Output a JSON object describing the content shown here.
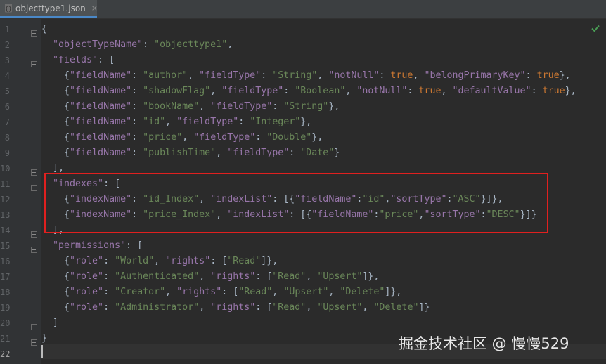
{
  "tab": {
    "title": "objecttype1.json",
    "close_glyph": "×",
    "icon": "json-file-icon"
  },
  "status": {
    "icon": "check-icon",
    "color": "#499c54"
  },
  "colors": {
    "key": "#9876aa",
    "string": "#6a8759",
    "keyword": "#cc7832",
    "punctuation": "#a9b7c6",
    "highlight_border": "#e0201f"
  },
  "editor": {
    "current_line": 22,
    "line_numbers": [
      "1",
      "2",
      "3",
      "4",
      "5",
      "6",
      "7",
      "8",
      "9",
      "10",
      "11",
      "12",
      "13",
      "14",
      "15",
      "16",
      "17",
      "18",
      "19",
      "20",
      "21",
      "22"
    ],
    "lines": [
      [
        [
          "p",
          "{"
        ]
      ],
      [
        [
          "p",
          "  "
        ],
        [
          "k",
          "\"objectTypeName\""
        ],
        [
          "p",
          ": "
        ],
        [
          "s",
          "\"objecttype1\""
        ],
        [
          "p",
          ","
        ]
      ],
      [
        [
          "p",
          "  "
        ],
        [
          "k",
          "\"fields\""
        ],
        [
          "p",
          ": ["
        ]
      ],
      [
        [
          "p",
          "    {"
        ],
        [
          "k",
          "\"fieldName\""
        ],
        [
          "p",
          ": "
        ],
        [
          "s",
          "\"author\""
        ],
        [
          "p",
          ", "
        ],
        [
          "k",
          "\"fieldType\""
        ],
        [
          "p",
          ": "
        ],
        [
          "s",
          "\"String\""
        ],
        [
          "p",
          ", "
        ],
        [
          "k",
          "\"notNull\""
        ],
        [
          "p",
          ": "
        ],
        [
          "kw",
          "true"
        ],
        [
          "p",
          ", "
        ],
        [
          "k",
          "\"belongPrimaryKey\""
        ],
        [
          "p",
          ": "
        ],
        [
          "kw",
          "true"
        ],
        [
          "p",
          "},"
        ]
      ],
      [
        [
          "p",
          "    {"
        ],
        [
          "k",
          "\"fieldName\""
        ],
        [
          "p",
          ": "
        ],
        [
          "s",
          "\"shadowFlag\""
        ],
        [
          "p",
          ", "
        ],
        [
          "k",
          "\"fieldType\""
        ],
        [
          "p",
          ": "
        ],
        [
          "s",
          "\"Boolean\""
        ],
        [
          "p",
          ", "
        ],
        [
          "k",
          "\"notNull\""
        ],
        [
          "p",
          ": "
        ],
        [
          "kw",
          "true"
        ],
        [
          "p",
          ", "
        ],
        [
          "k",
          "\"defaultValue\""
        ],
        [
          "p",
          ": "
        ],
        [
          "kw",
          "true"
        ],
        [
          "p",
          "},"
        ]
      ],
      [
        [
          "p",
          "    {"
        ],
        [
          "k",
          "\"fieldName\""
        ],
        [
          "p",
          ": "
        ],
        [
          "s",
          "\"bookName\""
        ],
        [
          "p",
          ", "
        ],
        [
          "k",
          "\"fieldType\""
        ],
        [
          "p",
          ": "
        ],
        [
          "s",
          "\"String\""
        ],
        [
          "p",
          "},"
        ]
      ],
      [
        [
          "p",
          "    {"
        ],
        [
          "k",
          "\"fieldName\""
        ],
        [
          "p",
          ": "
        ],
        [
          "s",
          "\"id\""
        ],
        [
          "p",
          ", "
        ],
        [
          "k",
          "\"fieldType\""
        ],
        [
          "p",
          ": "
        ],
        [
          "s",
          "\"Integer\""
        ],
        [
          "p",
          "},"
        ]
      ],
      [
        [
          "p",
          "    {"
        ],
        [
          "k",
          "\"fieldName\""
        ],
        [
          "p",
          ": "
        ],
        [
          "s",
          "\"price\""
        ],
        [
          "p",
          ", "
        ],
        [
          "k",
          "\"fieldType\""
        ],
        [
          "p",
          ": "
        ],
        [
          "s",
          "\"Double\""
        ],
        [
          "p",
          "},"
        ]
      ],
      [
        [
          "p",
          "    {"
        ],
        [
          "k",
          "\"fieldName\""
        ],
        [
          "p",
          ": "
        ],
        [
          "s",
          "\"publishTime\""
        ],
        [
          "p",
          ", "
        ],
        [
          "k",
          "\"fieldType\""
        ],
        [
          "p",
          ": "
        ],
        [
          "s",
          "\"Date\""
        ],
        [
          "p",
          "}"
        ]
      ],
      [
        [
          "p",
          "  ],"
        ]
      ],
      [
        [
          "p",
          "  "
        ],
        [
          "k",
          "\"indexes\""
        ],
        [
          "p",
          ": ["
        ]
      ],
      [
        [
          "p",
          "    {"
        ],
        [
          "k",
          "\"indexName\""
        ],
        [
          "p",
          ": "
        ],
        [
          "s",
          "\"id_Index\""
        ],
        [
          "p",
          ", "
        ],
        [
          "k",
          "\"indexList\""
        ],
        [
          "p",
          ": [{"
        ],
        [
          "k",
          "\"fieldName\""
        ],
        [
          "p",
          ":"
        ],
        [
          "s",
          "\"id\""
        ],
        [
          "p",
          ","
        ],
        [
          "k",
          "\"sortType\""
        ],
        [
          "p",
          ":"
        ],
        [
          "s",
          "\"ASC\""
        ],
        [
          "p",
          "}]},"
        ]
      ],
      [
        [
          "p",
          "    {"
        ],
        [
          "k",
          "\"indexName\""
        ],
        [
          "p",
          ": "
        ],
        [
          "s",
          "\"price_Index\""
        ],
        [
          "p",
          ", "
        ],
        [
          "k",
          "\"indexList\""
        ],
        [
          "p",
          ": [{"
        ],
        [
          "k",
          "\"fieldName\""
        ],
        [
          "p",
          ":"
        ],
        [
          "s",
          "\"price\""
        ],
        [
          "p",
          ","
        ],
        [
          "k",
          "\"sortType\""
        ],
        [
          "p",
          ":"
        ],
        [
          "s",
          "\"DESC\""
        ],
        [
          "p",
          "}]}"
        ]
      ],
      [
        [
          "p",
          "  ],"
        ]
      ],
      [
        [
          "p",
          "  "
        ],
        [
          "k",
          "\"permissions\""
        ],
        [
          "p",
          ": ["
        ]
      ],
      [
        [
          "p",
          "    {"
        ],
        [
          "k",
          "\"role\""
        ],
        [
          "p",
          ": "
        ],
        [
          "s",
          "\"World\""
        ],
        [
          "p",
          ", "
        ],
        [
          "k",
          "\"rights\""
        ],
        [
          "p",
          ": ["
        ],
        [
          "s",
          "\"Read\""
        ],
        [
          "p",
          "]},"
        ]
      ],
      [
        [
          "p",
          "    {"
        ],
        [
          "k",
          "\"role\""
        ],
        [
          "p",
          ": "
        ],
        [
          "s",
          "\"Authenticated\""
        ],
        [
          "p",
          ", "
        ],
        [
          "k",
          "\"rights\""
        ],
        [
          "p",
          ": ["
        ],
        [
          "s",
          "\"Read\""
        ],
        [
          "p",
          ", "
        ],
        [
          "s",
          "\"Upsert\""
        ],
        [
          "p",
          "]},"
        ]
      ],
      [
        [
          "p",
          "    {"
        ],
        [
          "k",
          "\"role\""
        ],
        [
          "p",
          ": "
        ],
        [
          "s",
          "\"Creator\""
        ],
        [
          "p",
          ", "
        ],
        [
          "k",
          "\"rights\""
        ],
        [
          "p",
          ": ["
        ],
        [
          "s",
          "\"Read\""
        ],
        [
          "p",
          ", "
        ],
        [
          "s",
          "\"Upsert\""
        ],
        [
          "p",
          ", "
        ],
        [
          "s",
          "\"Delete\""
        ],
        [
          "p",
          "]},"
        ]
      ],
      [
        [
          "p",
          "    {"
        ],
        [
          "k",
          "\"role\""
        ],
        [
          "p",
          ": "
        ],
        [
          "s",
          "\"Administrator\""
        ],
        [
          "p",
          ", "
        ],
        [
          "k",
          "\"rights\""
        ],
        [
          "p",
          ": ["
        ],
        [
          "s",
          "\"Read\""
        ],
        [
          "p",
          ", "
        ],
        [
          "s",
          "\"Upsert\""
        ],
        [
          "p",
          ", "
        ],
        [
          "s",
          "\"Delete\""
        ],
        [
          "p",
          "]}"
        ]
      ],
      [
        [
          "p",
          "  ]"
        ]
      ],
      [
        [
          "p",
          "}"
        ]
      ],
      []
    ],
    "fold_markers": [
      1,
      3,
      10,
      11,
      14,
      15,
      20,
      21
    ]
  },
  "watermark": {
    "text": "掘金技术社区 @ 慢慢529"
  }
}
